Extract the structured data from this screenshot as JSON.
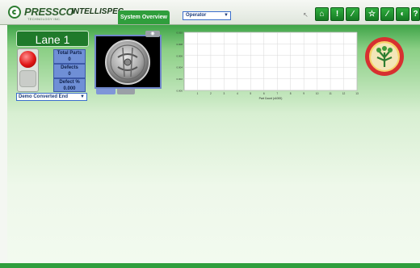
{
  "app": {
    "brand": "PRESSCO",
    "brand_sub": "TECHNOLOGY INC.",
    "product": "INTELLISPEC"
  },
  "tabs": [
    {
      "label": "System Overview",
      "active": true
    }
  ],
  "role_select": {
    "value": "Operator"
  },
  "toolbar": {
    "buttons": [
      {
        "icon": "home-icon",
        "glyph": "⌂"
      },
      {
        "icon": "alert-icon",
        "glyph": "!"
      },
      {
        "icon": "wrench-icon",
        "glyph": "∕"
      },
      {
        "icon": "star-icon",
        "glyph": "☆"
      },
      {
        "icon": "tools-icon",
        "glyph": "∕"
      },
      {
        "icon": "globe-icon",
        "glyph": "◐"
      },
      {
        "icon": "help-icon",
        "glyph": "?"
      }
    ]
  },
  "lane": {
    "title": "Lane 1",
    "stats": [
      {
        "label": "Total Parts",
        "value": "0"
      },
      {
        "label": "Defects",
        "value": "0"
      },
      {
        "label": "Defect %",
        "value": "0.000"
      }
    ],
    "indicator": "red",
    "converted_select": "Demo Converted End"
  },
  "colors": {
    "accent_green": "#2f9e3c",
    "select_blue": "#3b6ecb",
    "stat_blue": "#6f8fd6"
  },
  "chart_data": {
    "type": "line",
    "xlabel": "Part Count (x1000)",
    "ylabel": "",
    "x_ticks": [
      "1",
      "2",
      "3",
      "4",
      "5",
      "6",
      "7",
      "8",
      "9",
      "10",
      "11",
      "12",
      "13"
    ],
    "y_ticks": [
      "0.000",
      "0.002",
      "0.004",
      "0.006",
      "0.008",
      "0.010"
    ],
    "xlim": [
      0,
      13
    ],
    "ylim": [
      0,
      0.01
    ],
    "grid": true,
    "series": []
  }
}
